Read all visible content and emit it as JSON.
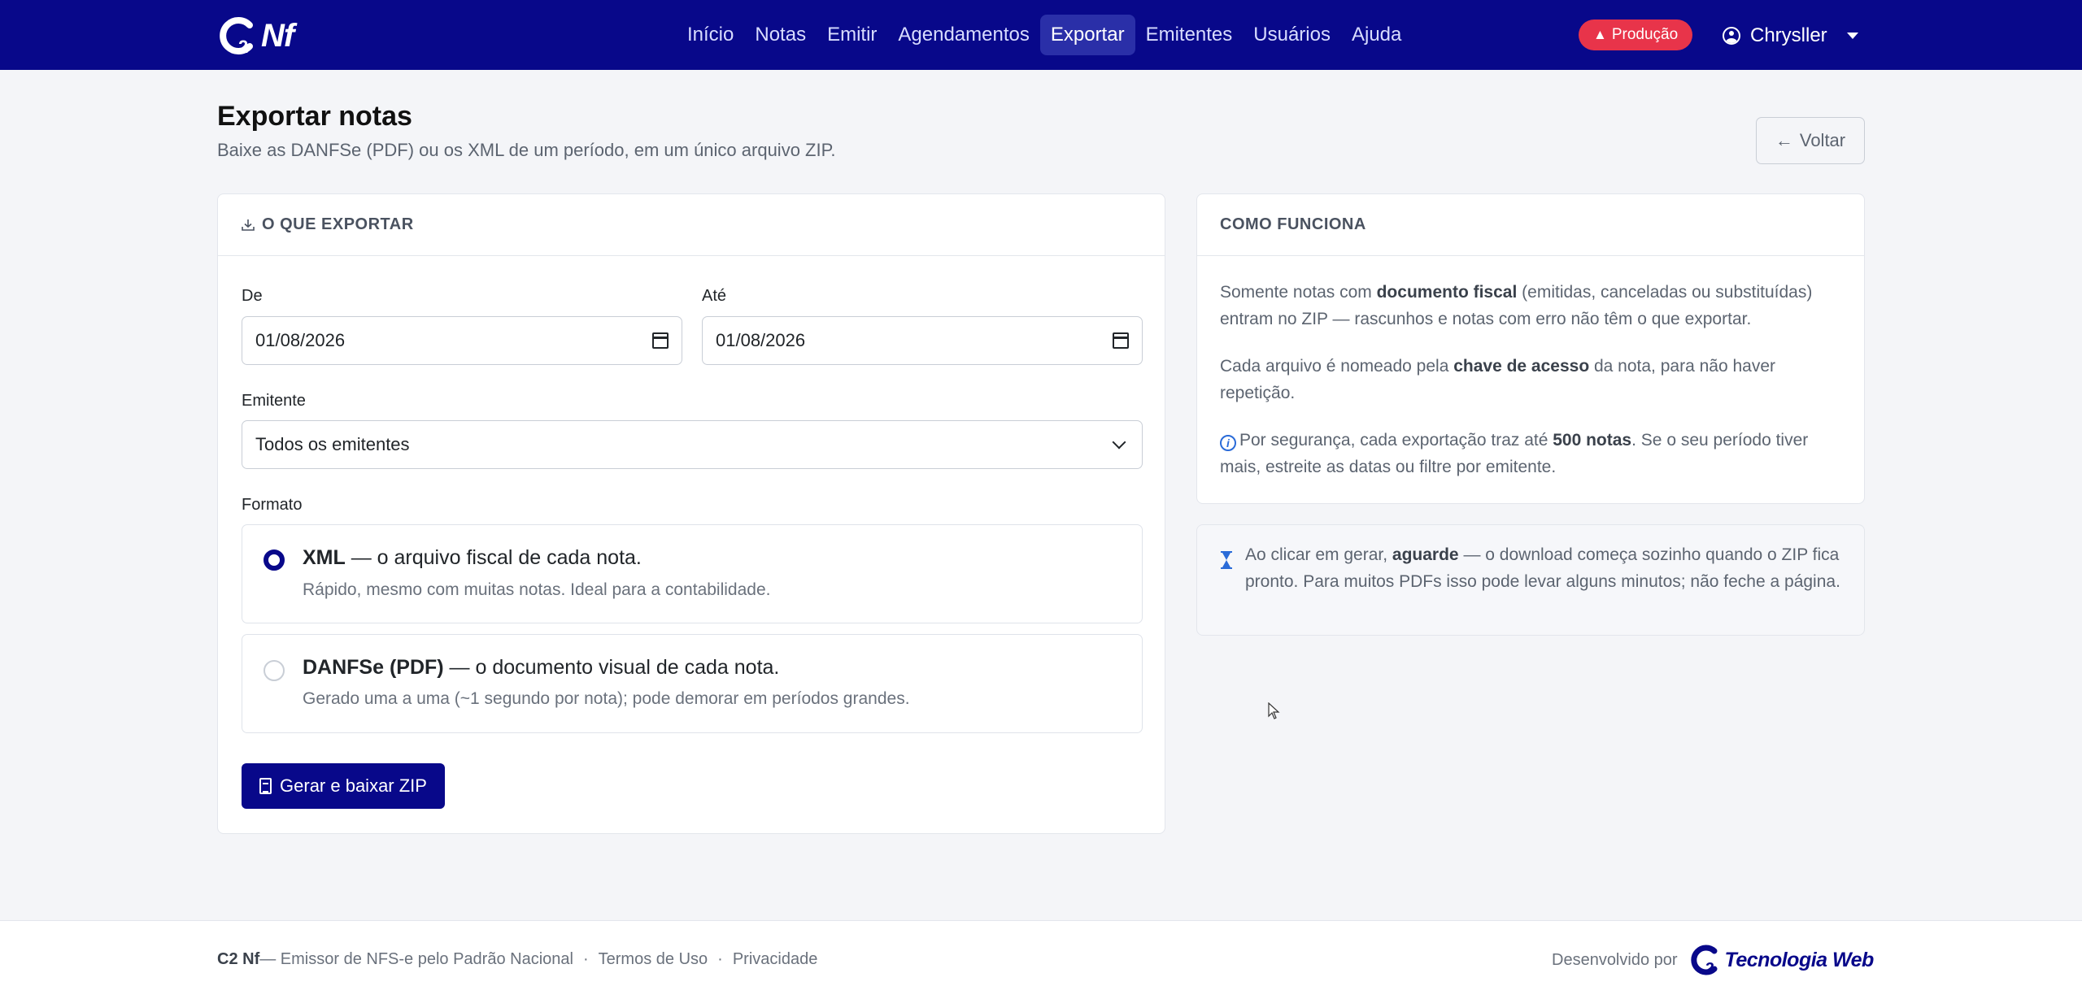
{
  "app": {
    "brand": "Nf",
    "brand_c2": "2"
  },
  "nav": {
    "items": [
      {
        "label": "Início"
      },
      {
        "label": "Notas"
      },
      {
        "label": "Emitir"
      },
      {
        "label": "Agendamentos"
      },
      {
        "label": "Exportar",
        "active": true
      },
      {
        "label": "Emitentes"
      },
      {
        "label": "Usuários"
      },
      {
        "label": "Ajuda"
      }
    ],
    "environment_badge": "Produção",
    "user_name": "Chrysller"
  },
  "page": {
    "title": "Exportar notas",
    "subtitle": "Baixe as DANFSe (PDF) ou os XML de um período, em um único arquivo ZIP.",
    "back_label": "Voltar"
  },
  "export_form": {
    "header": "O QUE EXPORTAR",
    "from_label": "De",
    "from_value": "01/08/2026",
    "to_label": "Até",
    "to_value": "01/08/2026",
    "issuer_label": "Emitente",
    "issuer_value": "Todos os emitentes",
    "format_label": "Formato",
    "options": [
      {
        "title_bold": "XML",
        "title_rest": " — o arquivo fiscal de cada nota.",
        "description": "Rápido, mesmo com muitas notas. Ideal para a contabilidade.",
        "checked": true
      },
      {
        "title_bold": "DANFSe (PDF)",
        "title_rest": " — o documento visual de cada nota.",
        "description": "Gerado uma a uma (~1 segundo por nota); pode demorar em períodos grandes.",
        "checked": false
      }
    ],
    "submit_label": "Gerar e baixar ZIP"
  },
  "how_it_works": {
    "header": "COMO FUNCIONA",
    "p1_a": "Somente notas com ",
    "p1_b": "documento fiscal",
    "p1_c": " (emitidas, canceladas ou substituídas) entram no ZIP — rascunhos e notas com erro não têm o que exportar.",
    "p2_a": "Cada arquivo é nomeado pela ",
    "p2_b": "chave de acesso",
    "p2_c": " da nota, para não haver repetição.",
    "p3_a": "Por segurança, cada exportação traz até ",
    "p3_b": "500 notas",
    "p3_c": ". Se o seu período tiver mais, estreite as datas ou filtre por emitente."
  },
  "wait_note": {
    "a": "Ao clicar em gerar, ",
    "b": "aguarde",
    "c": " — o download começa sozinho quando o ZIP fica pronto. Para muitos PDFs isso pode levar alguns minutos; não feche a página."
  },
  "footer": {
    "brand": "C2 Nf",
    "tagline": " — Emissor de NFS-e pelo Padrão Nacional",
    "sep": "·",
    "terms": "Termos de Uso",
    "privacy": "Privacidade",
    "developed_by": "Desenvolvido por",
    "company_num": "2",
    "company": "Tecnologia Web"
  },
  "colors": {
    "navbar": "#08088a",
    "active_nav": "#2a2fa8",
    "badge": "#e8344a",
    "primary": "#08088a",
    "page_bg": "#f4f5f8"
  }
}
